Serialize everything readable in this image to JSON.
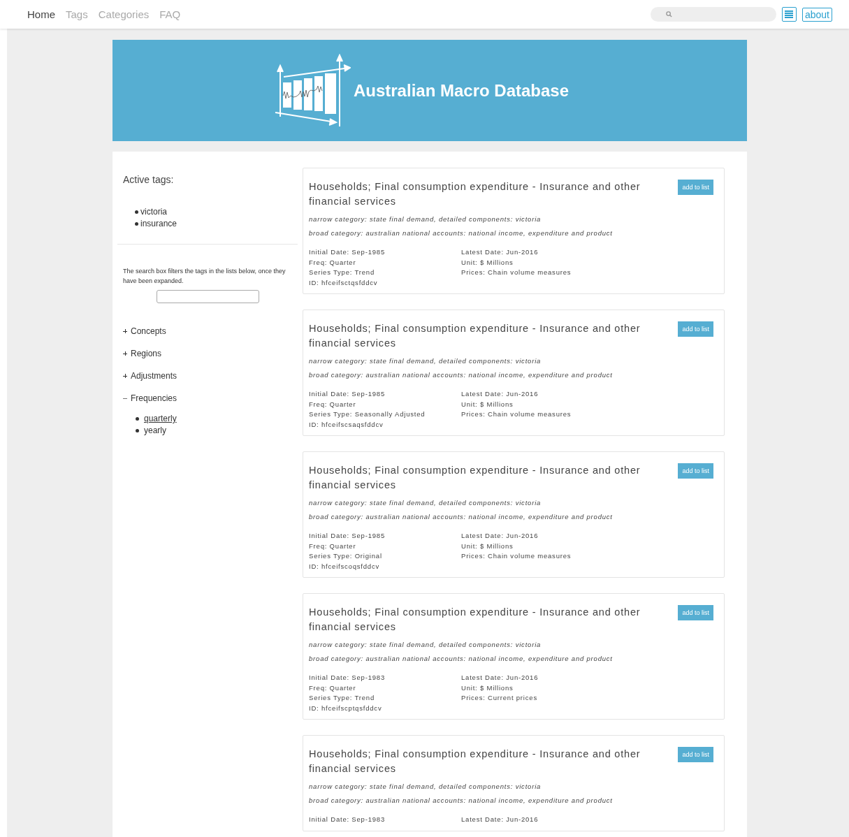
{
  "nav": {
    "links": [
      {
        "label": "Home",
        "selected": true
      },
      {
        "label": "Tags",
        "selected": false
      },
      {
        "label": "Categories",
        "selected": false
      },
      {
        "label": "FAQ",
        "selected": false
      }
    ],
    "about": "about"
  },
  "banner": {
    "title": "Australian Macro Database"
  },
  "sidebar": {
    "active_tags_title": "Active tags:",
    "active_tags": [
      "victoria",
      "insurance"
    ],
    "help": "The search box filters the tags in the lists below, once they have been expanded.",
    "groups": [
      {
        "label": "Concepts",
        "expanded": false
      },
      {
        "label": "Regions",
        "expanded": false
      },
      {
        "label": "Adjustments",
        "expanded": false
      },
      {
        "label": "Frequencies",
        "expanded": true,
        "children": [
          {
            "label": "quarterly",
            "underlined": true
          },
          {
            "label": "yearly",
            "underlined": false
          }
        ]
      }
    ]
  },
  "series": [
    {
      "title": "Households; Final consumption expenditure - Insurance and other financial services",
      "button": "add to list",
      "narrow": "narrow category: state final demand, detailed components: victoria",
      "broad": "broad category: australian national accounts: national income, expenditure and product",
      "left": [
        "Initial Date: Sep-1985",
        "Freq: Quarter",
        "Series Type: Trend",
        "ID: hfceifsctqsfddcv"
      ],
      "right": [
        "Latest Date: Jun-2016",
        "Unit: $ Millions",
        "Prices: Chain volume measures"
      ]
    },
    {
      "title": "Households; Final consumption expenditure - Insurance and other financial services",
      "button": "add to list",
      "narrow": "narrow category: state final demand, detailed components: victoria",
      "broad": "broad category: australian national accounts: national income, expenditure and product",
      "left": [
        "Initial Date: Sep-1985",
        "Freq: Quarter",
        "Series Type: Seasonally Adjusted",
        "ID: hfceifscsaqsfddcv"
      ],
      "right": [
        "Latest Date: Jun-2016",
        "Unit: $ Millions",
        "Prices: Chain volume measures"
      ]
    },
    {
      "title": "Households; Final consumption expenditure - Insurance and other financial services",
      "button": "add to list",
      "narrow": "narrow category: state final demand, detailed components: victoria",
      "broad": "broad category: australian national accounts: national income, expenditure and product",
      "left": [
        "Initial Date: Sep-1985",
        "Freq: Quarter",
        "Series Type: Original",
        "ID: hfceifscoqsfddcv"
      ],
      "right": [
        "Latest Date: Jun-2016",
        "Unit: $ Millions",
        "Prices: Chain volume measures"
      ]
    },
    {
      "title": "Households; Final consumption expenditure - Insurance and other financial services",
      "button": "add to list",
      "narrow": "narrow category: state final demand, detailed components: victoria",
      "broad": "broad category: australian national accounts: national income, expenditure and product",
      "left": [
        "Initial Date: Sep-1983",
        "Freq: Quarter",
        "Series Type: Trend",
        "ID: hfceifscptqsfddcv"
      ],
      "right": [
        "Latest Date: Jun-2016",
        "Unit: $ Millions",
        "Prices: Current prices"
      ]
    },
    {
      "title": "Households; Final consumption expenditure - Insurance and other financial services",
      "button": "add to list",
      "narrow": "narrow category: state final demand, detailed components: victoria",
      "broad": "broad category: australian national accounts: national income, expenditure and product",
      "left": [
        "Initial Date: Sep-1983"
      ],
      "right": [
        "Latest Date: Jun-2016"
      ]
    }
  ]
}
